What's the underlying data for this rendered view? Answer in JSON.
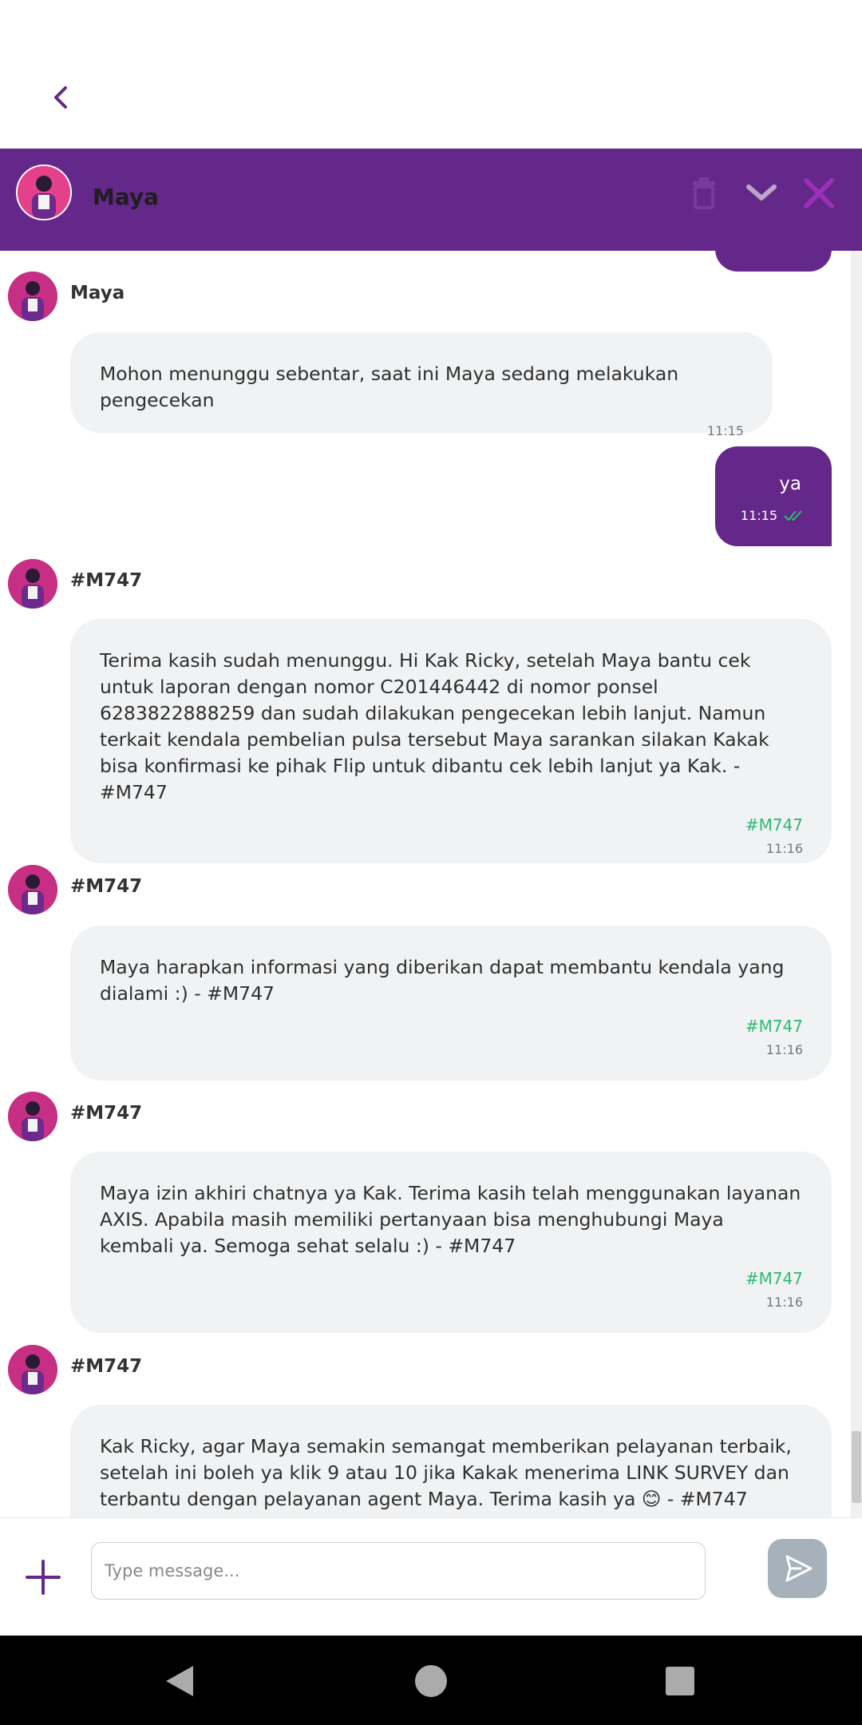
{
  "header": {
    "agent_name": "Maya",
    "icons": [
      "back-icon",
      "trash-icon",
      "chevron-down-icon",
      "close-icon"
    ],
    "color": "#64278a"
  },
  "messages": [
    {
      "sender": "Maya",
      "text": "Mohon menunggu sebentar, saat ini Maya sedang melakukan pengecekan",
      "time": "11:15"
    },
    {
      "outgoing_text": "ya",
      "time": "11:15"
    },
    {
      "sender": "#M747",
      "text": "Terima kasih sudah menunggu. Hi Kak Ricky, setelah Maya bantu cek untuk laporan dengan nomor C201446442 di nomor ponsel 6283822888259 dan sudah dilakukan pengecekan lebih lanjut. Namun terkait kendala pembelian pulsa tersebut Maya sarankan silakan Kakak bisa konfirmasi ke pihak Flip untuk dibantu cek lebih lanjut ya Kak. - #M747",
      "tag": "#M747",
      "time": "11:16"
    },
    {
      "sender": "#M747",
      "text": "Maya harapkan informasi yang diberikan dapat membantu kendala yang dialami :) - #M747",
      "tag": "#M747",
      "time": "11:16"
    },
    {
      "sender": "#M747",
      "text": "Maya izin akhiri chatnya ya Kak. Terima kasih telah menggunakan layanan AXIS. Apabila masih memiliki pertanyaan bisa menghubungi Maya kembali ya. Semoga sehat selalu :) - #M747",
      "tag": "#M747",
      "time": "11:16"
    },
    {
      "sender": "#M747",
      "text": "Kak Ricky, agar Maya semakin semangat memberikan pelayanan terbaik, setelah ini boleh ya klik 9 atau 10 jika Kakak menerima LINK SURVEY dan terbantu dengan pelayanan agent Maya. Terima kasih ya 😊 - #M747"
    }
  ],
  "composer": {
    "placeholder": "Type message...",
    "icons": [
      "plus-icon",
      "send-icon"
    ]
  },
  "colors": {
    "accent": "#64278a",
    "tag": "#2cbb6f",
    "bubble": "#f0f2f4"
  }
}
